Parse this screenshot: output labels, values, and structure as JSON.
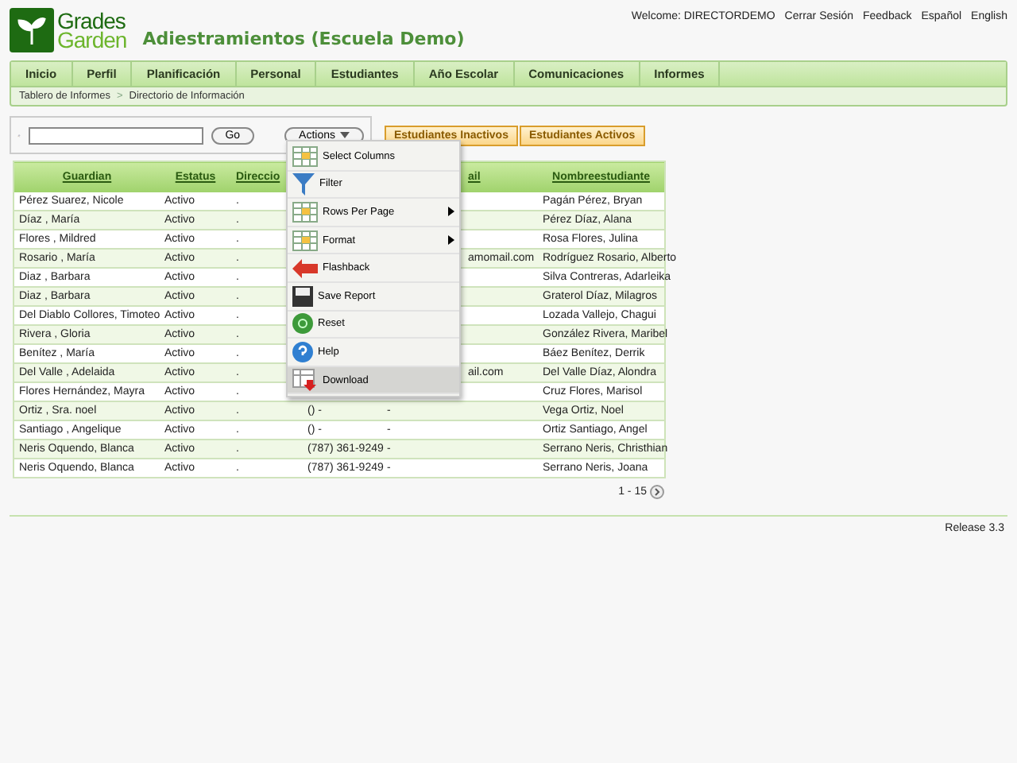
{
  "header": {
    "logo_top": "Grades",
    "logo_bottom": "Garden",
    "title": "Adiestramientos (Escuela Demo)",
    "welcome": "Welcome: DIRECTORDEMO",
    "links": [
      "Cerrar Sesión",
      "Feedback",
      "Español",
      "English"
    ]
  },
  "nav": {
    "tabs": [
      "Inicio",
      "Perfil",
      "Planificación",
      "Personal",
      "Estudiantes",
      "Año Escolar",
      "Comunicaciones",
      "Informes"
    ],
    "breadcrumb": [
      "Tablero de Informes",
      "Directorio de Información"
    ],
    "separator": ">"
  },
  "toolbar": {
    "go": "Go",
    "actions": "Actions",
    "filters": [
      {
        "label": "Estudiantes Inactivos"
      },
      {
        "label": "Estudiantes Activos"
      }
    ]
  },
  "table": {
    "columns": [
      {
        "label": "Guardian"
      },
      {
        "label": "Estatus"
      },
      {
        "label": "Direccio"
      },
      {},
      {
        "label": "ail",
        "partly_covered": true
      },
      {
        "label": "Nombreestudiante"
      }
    ],
    "rows": [
      {
        "cells": [
          "Pérez Suarez, Nicole",
          "Activo",
          ".",
          null,
          null,
          "Pagán Pérez, Bryan"
        ]
      },
      {
        "cells": [
          "Díaz , María",
          "Activo",
          ".",
          null,
          null,
          "Pérez Díaz, Alana"
        ]
      },
      {
        "cells": [
          "Flores , Mildred",
          "Activo",
          ".",
          null,
          null,
          "Rosa Flores, Julina"
        ]
      },
      {
        "cells": [
          "Rosario , María",
          "Activo",
          ".",
          null,
          "amomail.com",
          "Rodríguez Rosario, Alberto"
        ]
      },
      {
        "cells": [
          "Diaz , Barbara",
          "Activo",
          ".",
          null,
          null,
          "Silva Contreras, Adarleika"
        ]
      },
      {
        "cells": [
          "Diaz , Barbara",
          "Activo",
          ".",
          null,
          null,
          "Graterol Díaz, Milagros"
        ]
      },
      {
        "cells": [
          "Del Diablo Collores, Timoteo",
          "Activo",
          ".",
          null,
          null,
          "Lozada Vallejo, Chagui"
        ]
      },
      {
        "cells": [
          "Rivera , Gloria",
          "Activo",
          ".",
          null,
          null,
          "González Rivera, Maribel"
        ]
      },
      {
        "cells": [
          "Benítez , María",
          "Activo",
          ".",
          null,
          null,
          "Báez Benítez, Derrik"
        ]
      },
      {
        "cells": [
          "Del Valle , Adelaida",
          "Activo",
          ".",
          null,
          "ail.com",
          "Del Valle Díaz, Alondra"
        ]
      },
      {
        "cells": [
          "Flores Hernández, Mayra",
          "Activo",
          ".",
          null,
          null,
          "Cruz Flores, Marisol"
        ]
      },
      {
        "cells": [
          "Ortiz , Sra. noel",
          "Activo",
          ".",
          "() -",
          "-",
          "Vega Ortiz, Noel"
        ]
      },
      {
        "cells": [
          "Santiago , Angelique",
          "Activo",
          ".",
          "() -",
          "-",
          "Ortiz Santiago, Angel"
        ]
      },
      {
        "cells": [
          "Neris Oquendo, Blanca",
          "Activo",
          ".",
          "(787) 361-9249",
          "-",
          "Serrano Neris, Christhian"
        ]
      },
      {
        "cells": [
          "Neris Oquendo, Blanca",
          "Activo",
          ".",
          "(787) 361-9249",
          "-",
          "Serrano Neris, Joana"
        ]
      }
    ],
    "pagination": "1 - 15"
  },
  "menu": [
    {
      "label": "Select Columns",
      "kind": "grid",
      "submenu": false,
      "selected": false
    },
    {
      "label": "Filter",
      "kind": "funnel",
      "submenu": false,
      "selected": false
    },
    {
      "label": "Rows Per Page",
      "kind": "grid",
      "submenu": true,
      "selected": false
    },
    {
      "label": "Format",
      "kind": "grid",
      "submenu": true,
      "selected": false
    },
    {
      "label": "Flashback",
      "kind": "arrow",
      "submenu": false,
      "selected": false
    },
    {
      "label": "Save Report",
      "kind": "disk",
      "submenu": false,
      "selected": false
    },
    {
      "label": "Reset",
      "kind": "reset",
      "submenu": false,
      "selected": false
    },
    {
      "label": "Help",
      "kind": "help",
      "submenu": false,
      "selected": false
    },
    {
      "label": "Download",
      "kind": "download",
      "submenu": false,
      "selected": true
    }
  ],
  "footer": {
    "release": "Release 3.3"
  }
}
